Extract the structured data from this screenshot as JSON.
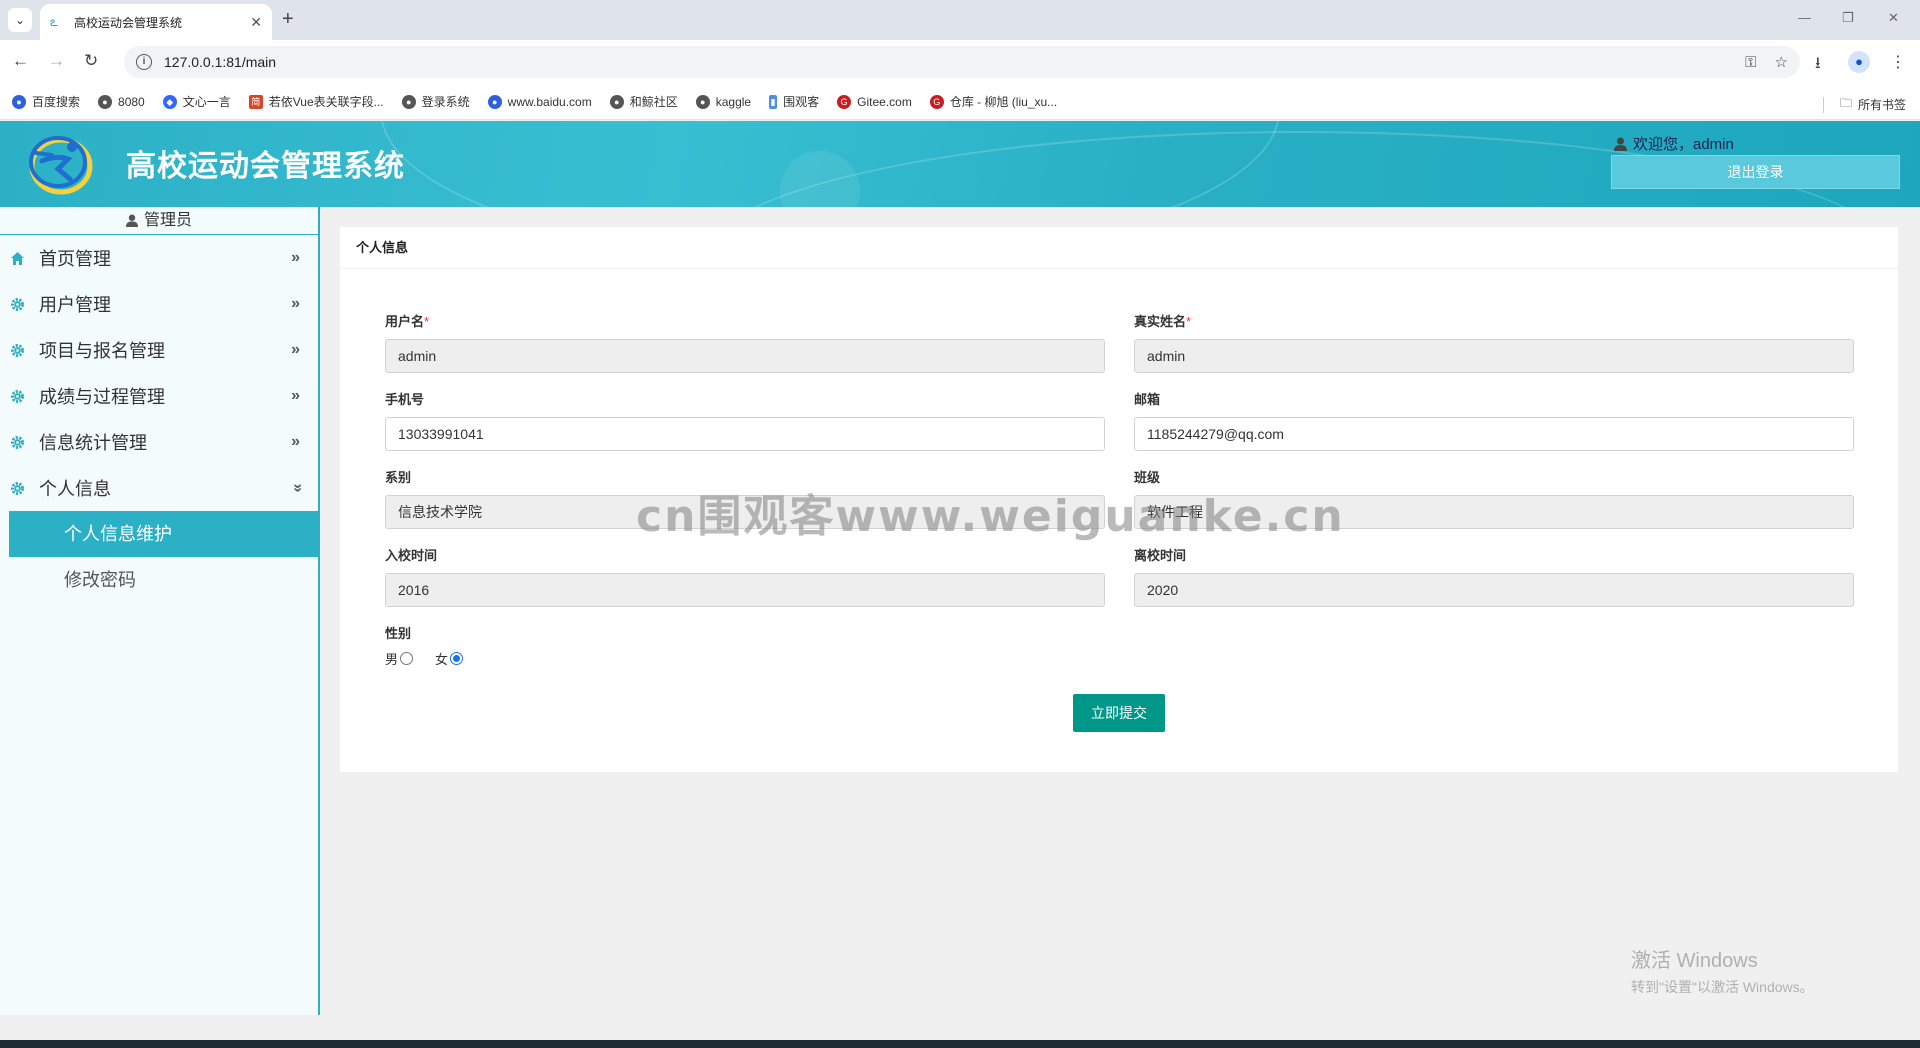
{
  "browser": {
    "tab_title": "高校运动会管理系统",
    "url": "127.0.0.1:81/main",
    "bookmarks": [
      {
        "label": "百度搜索",
        "color": "#2e5fdc"
      },
      {
        "label": "8080",
        "color": "#555555"
      },
      {
        "label": "文心一言",
        "color": "#3366ff"
      },
      {
        "label": "若依Vue表关联字段...",
        "color": "#d9472b"
      },
      {
        "label": "登录系统",
        "color": "#555555"
      },
      {
        "label": "www.baidu.com",
        "color": "#2e5fdc"
      },
      {
        "label": "和鲸社区",
        "color": "#555555"
      },
      {
        "label": "kaggle",
        "color": "#555555"
      },
      {
        "label": "围观客",
        "color": "#4a90e2"
      },
      {
        "label": "Gitee.com",
        "color": "#c71d23"
      },
      {
        "label": "仓库 - 柳旭 (liu_xu...",
        "color": "#c71d23"
      }
    ],
    "all_bookmarks": "所有书签"
  },
  "header": {
    "title": "高校运动会管理系统",
    "welcome": "欢迎您，admin",
    "logout": "退出登录"
  },
  "sidebar": {
    "role": "管理员",
    "menu": [
      {
        "label": "首页管理",
        "icon": "home-icon"
      },
      {
        "label": "用户管理",
        "icon": "gear-icon"
      },
      {
        "label": "项目与报名管理",
        "icon": "gear-icon"
      },
      {
        "label": "成绩与过程管理",
        "icon": "gear-icon"
      },
      {
        "label": "信息统计管理",
        "icon": "gear-icon"
      },
      {
        "label": "个人信息",
        "icon": "gear-icon",
        "expanded": true
      }
    ],
    "submenu": [
      {
        "label": "个人信息维护",
        "active": true
      },
      {
        "label": "修改密码",
        "active": false
      }
    ]
  },
  "form": {
    "panel_title": "个人信息",
    "username": {
      "label": "用户名",
      "value": "admin"
    },
    "realname": {
      "label": "真实姓名",
      "value": "admin"
    },
    "phone": {
      "label": "手机号",
      "value": "13033991041"
    },
    "email": {
      "label": "邮箱",
      "value": "1185244279@qq.com"
    },
    "department": {
      "label": "系别",
      "value": "信息技术学院"
    },
    "class": {
      "label": "班级",
      "value": "软件工程"
    },
    "enroll_year": {
      "label": "入校时间",
      "value": "2016"
    },
    "leave_year": {
      "label": "离校时间",
      "value": "2020"
    },
    "gender": {
      "label": "性别",
      "male": "男",
      "female": "女",
      "selected": "女"
    },
    "submit": "立即提交"
  },
  "watermark": "cn围观客www.weiguanke.cn",
  "os": {
    "activate_title": "激活 Windows",
    "activate_hint": "转到\"设置\"以激活 Windows。"
  },
  "colors": {
    "accent": "#2bb0c6",
    "submit": "#009688"
  }
}
